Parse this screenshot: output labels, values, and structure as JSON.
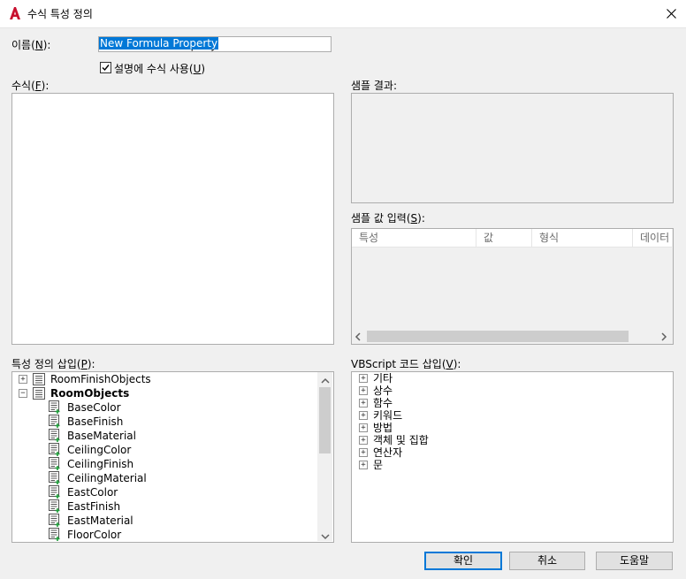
{
  "window": {
    "title": "수식 특성 정의",
    "app_icon": "autocad-a-icon",
    "close_icon": "close-icon"
  },
  "name": {
    "label_prefix": "이름(",
    "label_key": "N",
    "label_suffix": "):",
    "value": "New Formula Property"
  },
  "use_in_description": {
    "checked": true,
    "label_prefix": "설명에 수식 사용(",
    "label_key": "U",
    "label_suffix": ")"
  },
  "formula": {
    "label_prefix": "수식(",
    "label_key": "F",
    "label_suffix": "):",
    "value": ""
  },
  "sample_result": {
    "label": "샘플 결과:"
  },
  "sample_input": {
    "label_prefix": "샘플 값 입력(",
    "label_key": "S",
    "label_suffix": "):",
    "columns": [
      "특성",
      "값",
      "형식",
      "데이터"
    ]
  },
  "insert_property": {
    "label_prefix": "특성 정의 삽입(",
    "label_key": "P",
    "label_suffix": "):",
    "tree": [
      {
        "label": "RoomFinishObjects",
        "level": 0,
        "expander": "+",
        "bold": false,
        "icon": "property-set-icon"
      },
      {
        "label": "RoomObjects",
        "level": 0,
        "expander": "−",
        "bold": true,
        "icon": "property-set-icon"
      },
      {
        "label": "BaseColor",
        "level": 1,
        "icon": "property-definition-icon"
      },
      {
        "label": "BaseFinish",
        "level": 1,
        "icon": "property-definition-icon"
      },
      {
        "label": "BaseMaterial",
        "level": 1,
        "icon": "property-definition-icon"
      },
      {
        "label": "CeilingColor",
        "level": 1,
        "icon": "property-definition-icon"
      },
      {
        "label": "CeilingFinish",
        "level": 1,
        "icon": "property-definition-icon"
      },
      {
        "label": "CeilingMaterial",
        "level": 1,
        "icon": "property-definition-icon"
      },
      {
        "label": "EastColor",
        "level": 1,
        "icon": "property-definition-icon"
      },
      {
        "label": "EastFinish",
        "level": 1,
        "icon": "property-definition-icon"
      },
      {
        "label": "EastMaterial",
        "level": 1,
        "icon": "property-definition-icon"
      },
      {
        "label": "FloorColor",
        "level": 1,
        "icon": "property-definition-icon"
      }
    ]
  },
  "insert_vbscript": {
    "label_prefix": "VBScript 코드 삽입(",
    "label_key": "V",
    "label_suffix": "):",
    "tree": [
      "기타",
      "상수",
      "함수",
      "키워드",
      "방법",
      "객체 및 집합",
      "연산자",
      "문"
    ]
  },
  "buttons": {
    "ok": "확인",
    "cancel": "취소",
    "help": "도움말"
  },
  "colors": {
    "accent": "#0078d7",
    "selection": "#0078d7",
    "autocad_red": "#c8102e"
  }
}
